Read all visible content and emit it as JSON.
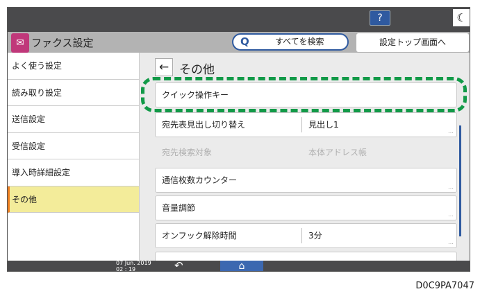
{
  "topbar": {
    "help_label": "?",
    "sleep_icon": "moon-icon"
  },
  "header": {
    "app_title": "ファクス設定",
    "app_icon": "fax-icon",
    "search_label": "すべてを検索",
    "settings_top_label": "設定トップ画面へ"
  },
  "sidebar": {
    "items": [
      {
        "label": "よく使う設定"
      },
      {
        "label": "読み取り設定"
      },
      {
        "label": "送信設定"
      },
      {
        "label": "受信設定"
      },
      {
        "label": "導入時詳細設定"
      },
      {
        "label": "その他",
        "selected": true
      }
    ]
  },
  "main": {
    "title": "その他",
    "back_icon": "←",
    "rows": [
      {
        "label": "クイック操作キー",
        "value": ""
      },
      {
        "label": "宛先表見出し切り替え",
        "value": "見出し1"
      },
      {
        "label": "宛先検索対象",
        "value": "本体アドレス帳",
        "disabled": true
      },
      {
        "label": "通信枚数カウンター",
        "value": ""
      },
      {
        "label": "音量調節",
        "value": ""
      },
      {
        "label": "オンフック解除時間",
        "value": "3分"
      }
    ]
  },
  "bottombar": {
    "date": "07 Jun. 2019",
    "time": "02 : 19"
  },
  "colors": {
    "highlight": "#129a48",
    "accent": "#2f5aa0",
    "selected": "#f3ec9a"
  },
  "figure_code": "D0C9PA7047"
}
